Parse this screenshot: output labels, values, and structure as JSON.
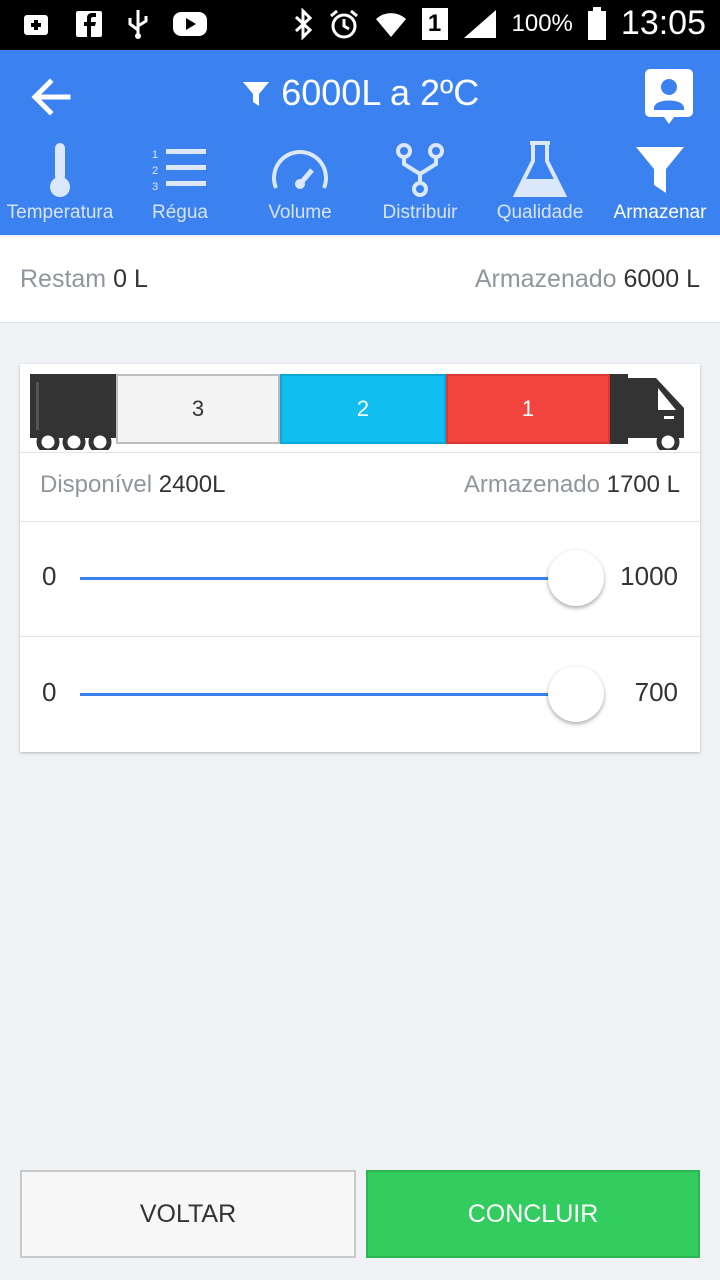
{
  "status_bar": {
    "battery": "100%",
    "time": "13:05",
    "sim_badge": "1",
    "icons": [
      "add-box-icon",
      "facebook-icon",
      "usb-icon",
      "youtube-icon",
      "bluetooth-icon",
      "alarm-icon",
      "wifi-icon",
      "signal-icon",
      "battery-icon"
    ]
  },
  "app_bar": {
    "title": "6000L a 2ºC",
    "tabs": [
      {
        "label": "Temperatura",
        "icon": "thermometer-icon"
      },
      {
        "label": "Régua",
        "icon": "ruler-list-icon"
      },
      {
        "label": "Volume",
        "icon": "gauge-icon"
      },
      {
        "label": "Distribuir",
        "icon": "distribute-icon"
      },
      {
        "label": "Qualidade",
        "icon": "flask-icon"
      },
      {
        "label": "Armazenar",
        "icon": "filter-icon",
        "active": true
      }
    ]
  },
  "summary": {
    "remaining_label": "Restam",
    "remaining_value": "0 L",
    "stored_label": "Armazenado",
    "stored_value": "6000 L"
  },
  "truck": {
    "compartments": [
      {
        "label": "3",
        "color": "#f4f4f4"
      },
      {
        "label": "2",
        "color": "#10bef0"
      },
      {
        "label": "1",
        "color": "#f2453d"
      }
    ],
    "available_label": "Disponível",
    "available_value": "2400L",
    "stored_label": "Armazenado",
    "stored_value": "1700 L"
  },
  "sliders": [
    {
      "min": "0",
      "max": "1000",
      "fraction": 1.0
    },
    {
      "min": "0",
      "max": "700",
      "fraction": 1.0
    }
  ],
  "buttons": {
    "back": "VOLTAR",
    "done": "CONCLUIR"
  },
  "colors": {
    "primary": "#3b82f0",
    "success": "#33cc5f",
    "background": "#f0f3f6"
  }
}
